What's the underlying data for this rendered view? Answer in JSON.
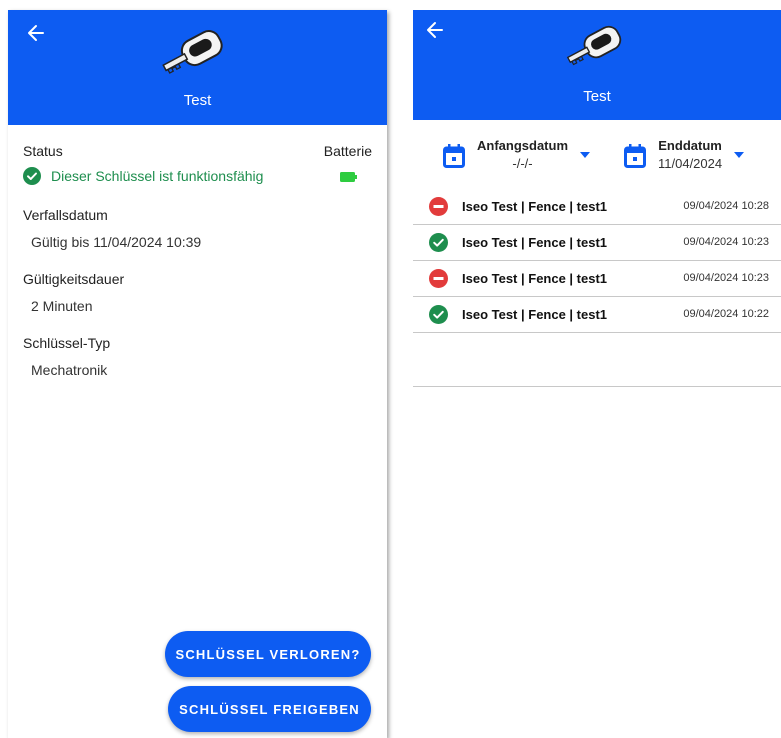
{
  "left": {
    "header": {
      "title": "Test"
    },
    "status": {
      "label": "Status",
      "text": "Dieser Schlüssel ist funktionsfähig",
      "battery_label": "Batterie"
    },
    "expiry": {
      "label": "Verfallsdatum",
      "value": "Gültig bis 11/04/2024 10:39"
    },
    "duration": {
      "label": "Gültigkeitsdauer",
      "value": "2 Minuten"
    },
    "key_type": {
      "label": "Schlüssel-Typ",
      "value": "Mechatronik"
    },
    "buttons": {
      "lost": "SCHLÜSSEL VERLOREN?",
      "release": "SCHLÜSSEL FREIGEBEN"
    }
  },
  "right": {
    "header": {
      "title": "Test"
    },
    "start_date": {
      "label": "Anfangsdatum",
      "value": "-/-/-"
    },
    "end_date": {
      "label": "Enddatum",
      "value": "11/04/2024"
    },
    "events": [
      {
        "status": "denied",
        "name": "Iseo Test | Fence | test1",
        "time": "09/04/2024 10:28"
      },
      {
        "status": "granted",
        "name": "Iseo Test | Fence | test1",
        "time": "09/04/2024 10:23"
      },
      {
        "status": "denied",
        "name": "Iseo Test | Fence | test1",
        "time": "09/04/2024 10:23"
      },
      {
        "status": "granted",
        "name": "Iseo Test | Fence | test1",
        "time": "09/04/2024 10:22"
      }
    ]
  },
  "colors": {
    "brand_blue": "#0d5cf2",
    "success_green": "#1e8e4e",
    "error_red": "#e23b3b",
    "battery_green": "#2ecc40"
  }
}
